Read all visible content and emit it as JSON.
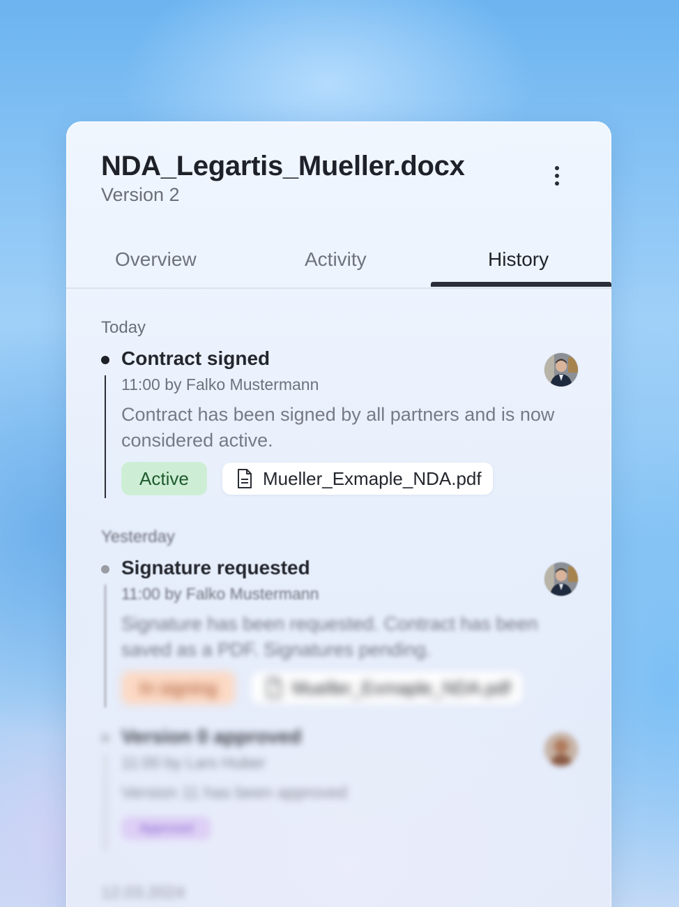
{
  "document": {
    "title": "NDA_Legartis_Mueller.docx",
    "version": "Version 2",
    "more_icon": "more-vertical-icon"
  },
  "tabs": [
    {
      "label": "Overview",
      "active": false
    },
    {
      "label": "Activity",
      "active": false
    },
    {
      "label": "History",
      "active": true
    }
  ],
  "history": {
    "groups": [
      {
        "label": "Today",
        "entries": [
          {
            "title": "Contract signed",
            "meta": "11:00 by Falko Mustermann",
            "description": "Contract has been signed by all partners and is now considered active.",
            "badge": "Active",
            "badge_color": "#cdeed4",
            "badge_text_color": "#1f5a2e",
            "file": "Mueller_Exmaple_NDA.pdf",
            "file_icon": "document-icon",
            "avatar": "avatar-man"
          }
        ]
      },
      {
        "label": "Yesterday",
        "entries": [
          {
            "title": "Signature requested",
            "meta": "11:00 by Falko Mustermann",
            "description": "Signature has been requested. Contract has been saved as a PDF. Signatures pending.",
            "badge": "In signing",
            "badge_color": "#fcd9c4",
            "badge_text_color": "#a4512a",
            "file": "Mueller_Exmaple_NDA.pdf",
            "file_icon": "document-icon",
            "avatar": "avatar-man"
          },
          {
            "title": "Version 0 approved",
            "meta": "11:00 by Lars Huber",
            "description": "Version 11 has been approved",
            "badge": "Approved",
            "badge_color": "#dccbf5",
            "badge_text_color": "#7a4fc9",
            "avatar": "avatar-woman"
          }
        ]
      },
      {
        "label": "12.03.2024",
        "entries": []
      }
    ]
  }
}
